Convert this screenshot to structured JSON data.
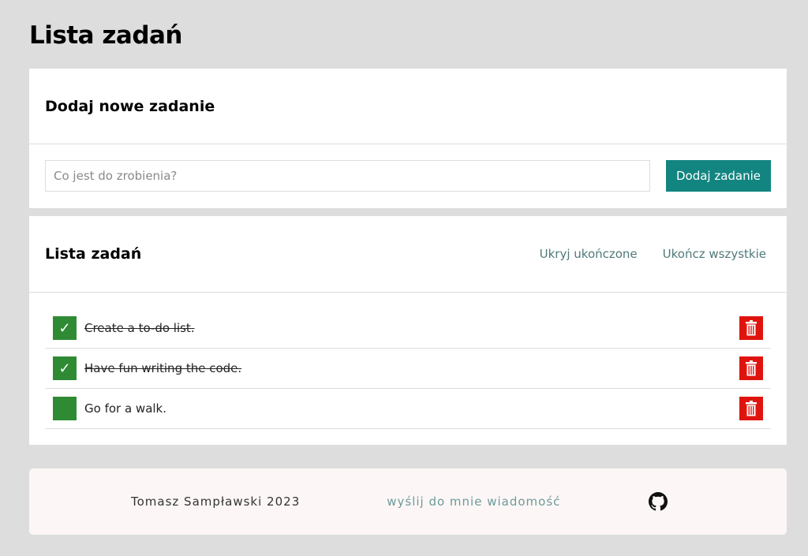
{
  "page": {
    "title": "Lista zadań"
  },
  "add_section": {
    "heading": "Dodaj nowe zadanie",
    "input_placeholder": "Co jest do zrobienia?",
    "input_value": "",
    "submit_label": "Dodaj zadanie"
  },
  "list_section": {
    "heading": "Lista zadań",
    "hide_done_label": "Ukryj ukończone",
    "finish_all_label": "Ukończ wszystkie",
    "tasks": [
      {
        "content": "Create a to-do list.",
        "done": true
      },
      {
        "content": "Have fun writing the code.",
        "done": true
      },
      {
        "content": "Go for a walk.",
        "done": false
      }
    ]
  },
  "footer": {
    "author": "Tomasz Sampławski 2023",
    "contact_label": "wyślij do mnie wiadomość",
    "github_icon": "github-icon"
  },
  "colors": {
    "background": "#dddddd",
    "accent": "#138580",
    "done": "#2e8b34",
    "delete": "#e0140e",
    "link": "#4f7a7a",
    "footer_bg": "#fcf7f6"
  }
}
